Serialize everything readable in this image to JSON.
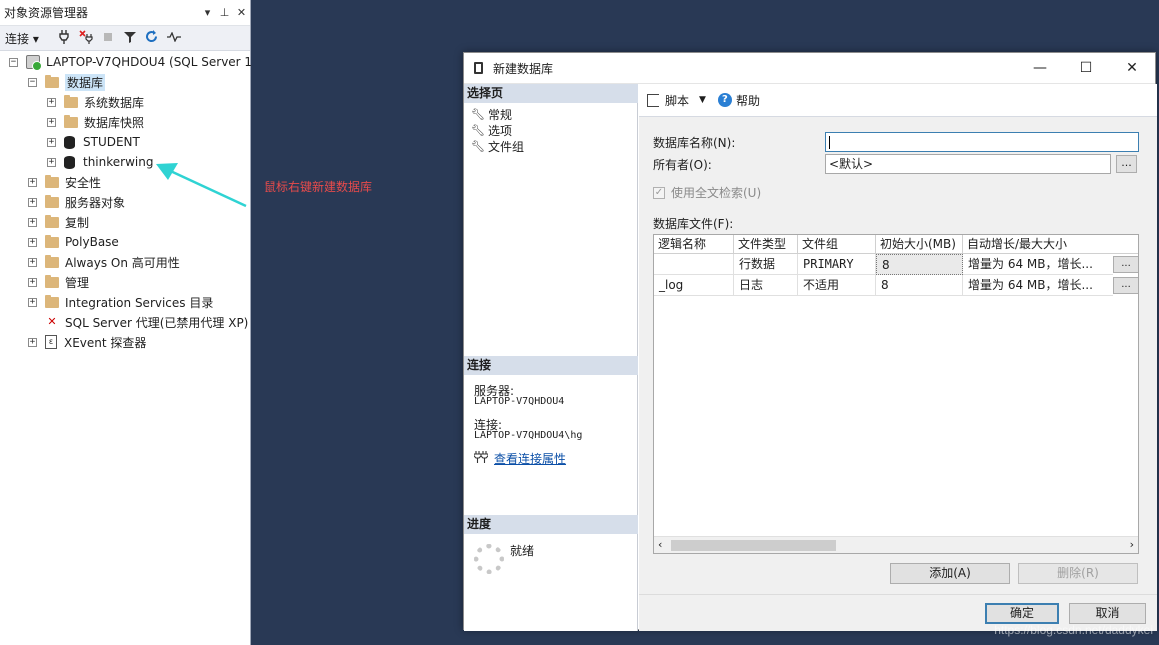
{
  "object_explorer": {
    "title": "对象资源管理器",
    "title_buttons": [
      "▾",
      "⊥",
      "✕"
    ],
    "toolbar": {
      "connect_label": "连接 ▾"
    },
    "tree": {
      "server": "LAPTOP-V7QHDOU4 (SQL Server 1",
      "databases": "数据库",
      "system_databases": "系统数据库",
      "database_snapshots": "数据库快照",
      "db_student": "STUDENT",
      "db_thinkerwing": "thinkerwing",
      "security": "安全性",
      "server_objects": "服务器对象",
      "replication": "复制",
      "polybase": "PolyBase",
      "always_on": "Always On 高可用性",
      "management": "管理",
      "integration_services": "Integration Services 目录",
      "sql_agent": "SQL Server 代理(已禁用代理 XP)",
      "xevent": "XEvent 探查器"
    }
  },
  "annotation": {
    "text": "鼠标右键新建数据库",
    "color": "#e84b4b"
  },
  "dialog": {
    "title": "新建数据库",
    "window_buttons": [
      "—",
      "☐",
      "✕"
    ],
    "select_page": {
      "header": "选择页",
      "items": [
        "常规",
        "选项",
        "文件组"
      ]
    },
    "connection": {
      "header": "连接",
      "server_label": "服务器:",
      "server_value": "LAPTOP-V7QHDOU4",
      "connection_label": "连接:",
      "connection_value": "LAPTOP-V7QHDOU4\\hg",
      "view_props": "查看连接属性"
    },
    "progress": {
      "header": "进度",
      "status": "就绪"
    },
    "toolbar": {
      "script": "脚本",
      "help": "帮助"
    },
    "form": {
      "db_name_label": "数据库名称(N):",
      "db_name_value": "",
      "owner_label": "所有者(O):",
      "owner_value": "<默认>",
      "fulltext_label": "使用全文检索(U)",
      "files_label": "数据库文件(F):"
    },
    "grid": {
      "columns": [
        "逻辑名称",
        "文件类型",
        "文件组",
        "初始大小(MB)",
        "自动增长/最大大小"
      ],
      "rows": [
        [
          "",
          "行数据",
          "PRIMARY",
          "8",
          "增量为 64 MB，增长..."
        ],
        [
          "_log",
          "日志",
          "不适用",
          "8",
          "增量为 64 MB，增长..."
        ]
      ],
      "ellipsis": "..."
    },
    "buttons": {
      "add": "添加(A)",
      "remove": "删除(R)",
      "ok": "确定",
      "cancel": "取消"
    }
  },
  "watermark": "https://blog.csdn.net/daddykei"
}
